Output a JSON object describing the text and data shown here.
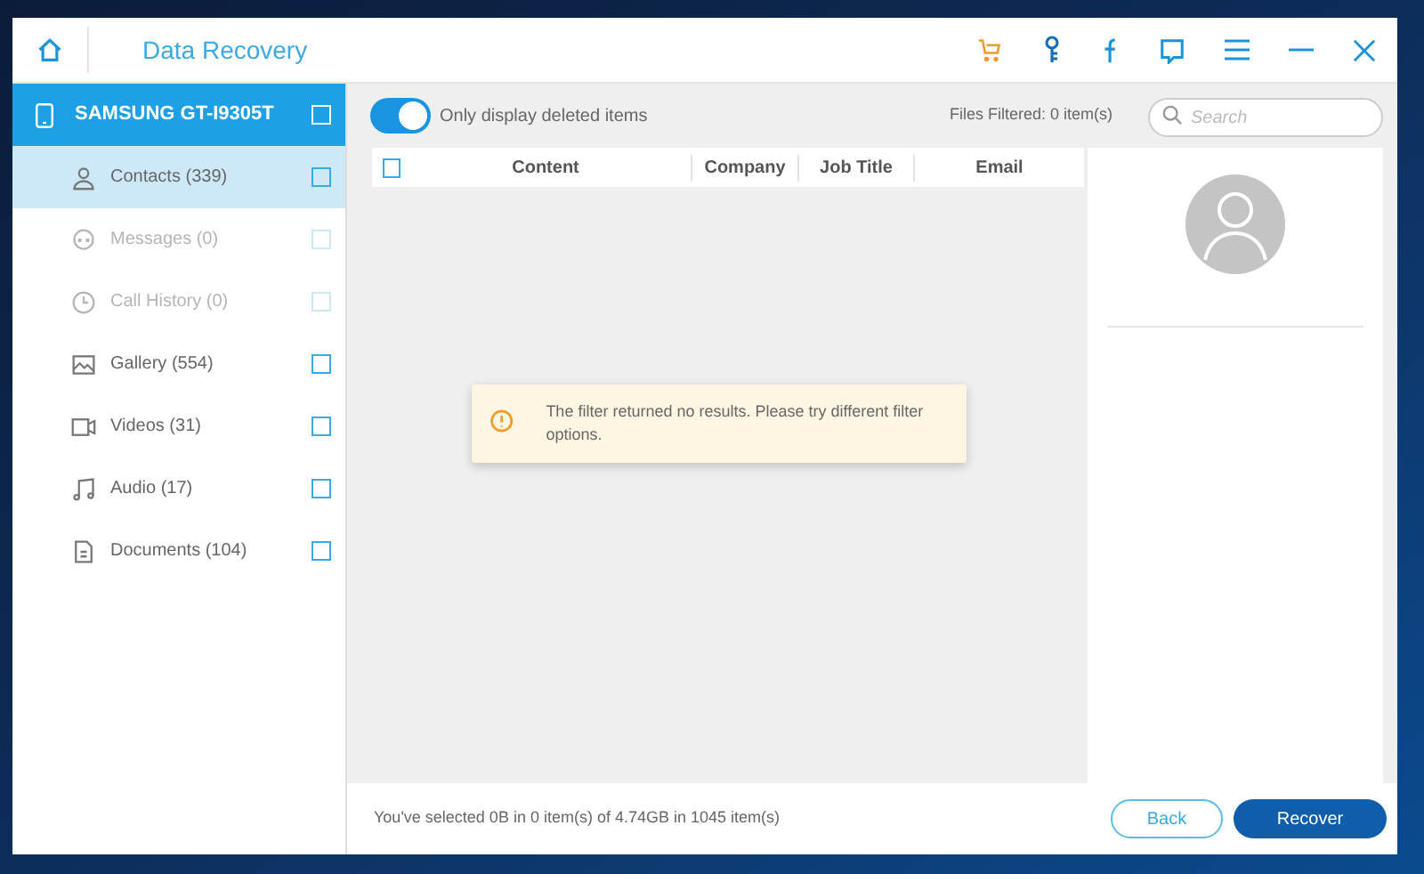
{
  "window": {
    "title": "Data Recovery"
  },
  "device": {
    "name": "SAMSUNG GT-I9305T",
    "checked": false
  },
  "sidebar": {
    "items": [
      {
        "kind": "contacts",
        "label": "Contacts (339)",
        "selected": true,
        "disabled": false,
        "checked": false
      },
      {
        "kind": "messages",
        "label": "Messages (0)",
        "selected": false,
        "disabled": true,
        "checked": false
      },
      {
        "kind": "calls",
        "label": "Call History (0)",
        "selected": false,
        "disabled": true,
        "checked": false
      },
      {
        "kind": "gallery",
        "label": "Gallery (554)",
        "selected": false,
        "disabled": false,
        "checked": false
      },
      {
        "kind": "videos",
        "label": "Videos (31)",
        "selected": false,
        "disabled": false,
        "checked": false
      },
      {
        "kind": "audio",
        "label": "Audio (17)",
        "selected": false,
        "disabled": false,
        "checked": false
      },
      {
        "kind": "documents",
        "label": "Documents (104)",
        "selected": false,
        "disabled": false,
        "checked": false
      }
    ]
  },
  "toolbar": {
    "toggle": {
      "label": "Only display deleted items",
      "on": true
    },
    "files_filtered": "Files Filtered: 0 item(s)",
    "search": {
      "placeholder": "Search"
    }
  },
  "table": {
    "select_all_checked": false,
    "columns": [
      "Content",
      "Company",
      "Job Title",
      "Email"
    ]
  },
  "notice": {
    "message": "The filter returned no results. Please try different filter options."
  },
  "footer": {
    "summary": "You've selected 0B in 0 item(s) of 4.74GB in 1045 item(s)",
    "buttons": [
      "Back",
      "Recover"
    ]
  }
}
